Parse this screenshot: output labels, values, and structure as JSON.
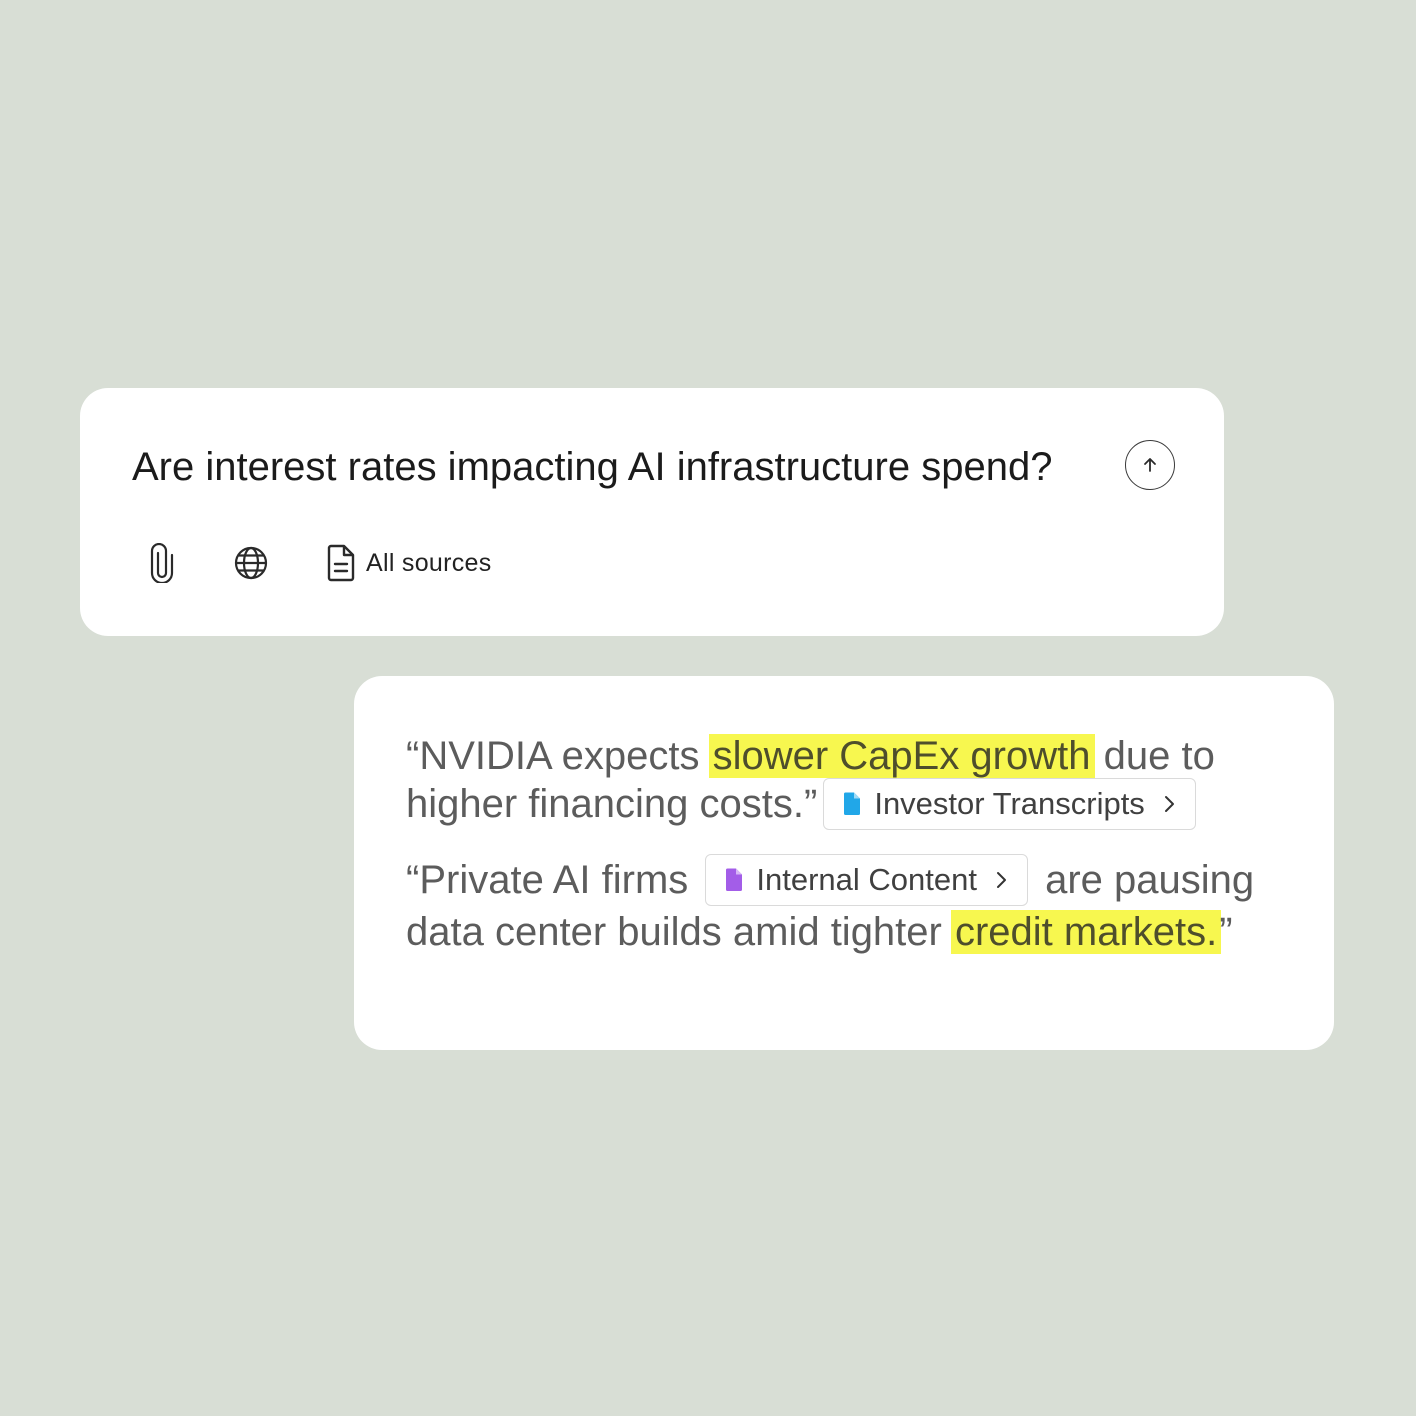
{
  "colors": {
    "background": "#d8ded5",
    "card": "#ffffff",
    "highlight": "#f7f74f",
    "investor_icon": "#21a7e8",
    "internal_icon": "#a35de8"
  },
  "query": {
    "text": "Are interest rates impacting AI infrastructure spend?",
    "send_icon": "arrow-up-icon",
    "tools": {
      "attach_icon": "paperclip-icon",
      "web_icon": "globe-icon",
      "sources_icon": "document-icon",
      "sources_label": "All sources"
    }
  },
  "answer": {
    "quote1": {
      "before": "“NVIDIA expects ",
      "highlight": "slower CapEx growth",
      "after": " due to higher financing costs.”",
      "source": {
        "label": "Investor Transcripts",
        "icon": "file-icon"
      }
    },
    "quote2": {
      "before": "“Private AI firms ",
      "source": {
        "label": "Internal Content",
        "icon": "file-icon"
      },
      "middle": " are pausing data center builds amid tighter ",
      "highlight": "credit markets.",
      "after": "”"
    }
  }
}
